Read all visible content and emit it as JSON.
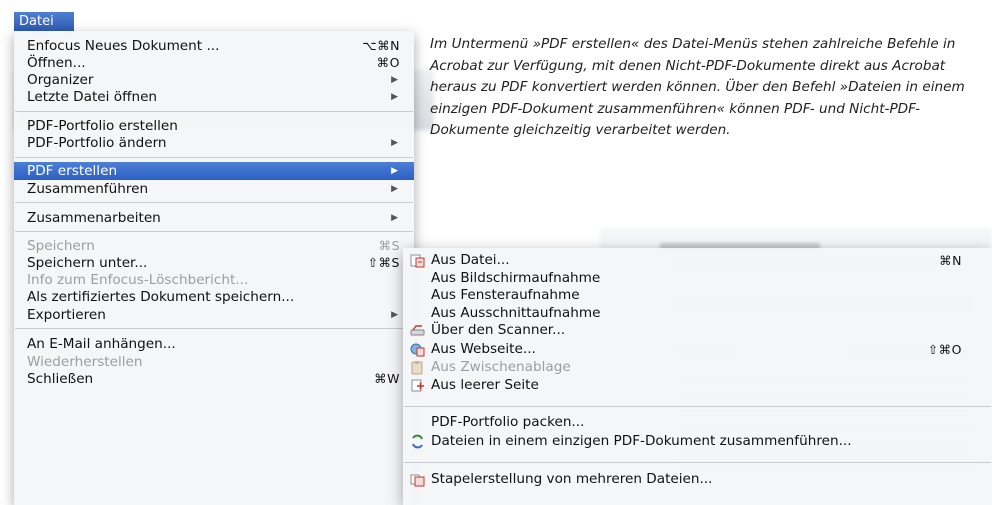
{
  "menubar": {
    "title": "Datei"
  },
  "caption": "Im Untermenü »PDF erstellen« des Datei-Menüs stehen zahlreiche Befehle in Acrobat zur Verfügung, mit denen Nicht-PDF-Dokumente direkt aus Acrobat heraus zu PDF konvertiert werden können. Über den Befehl »Dateien in einem einzigen PDF-Dokument zusammenfüh­ren« können PDF- und Nicht-PDF-Dokumente gleichzeitig verarbeitet werden.",
  "menu": {
    "items": [
      {
        "label": "Enfocus Neues Dokument ...",
        "shortcut": "⌥⌘N"
      },
      {
        "label": "Öffnen...",
        "shortcut": "⌘O"
      },
      {
        "label": "Organizer",
        "submenu_arrow": "▶"
      },
      {
        "label": "Letzte Datei öffnen",
        "submenu_arrow": "▶"
      },
      {
        "label": "PDF-Portfolio erstellen"
      },
      {
        "label": "PDF-Portfolio ändern",
        "submenu_arrow": "▶"
      },
      {
        "label": "PDF erstellen",
        "submenu_arrow": "▶",
        "highlighted": true
      },
      {
        "label": "Zusammenführen",
        "submenu_arrow": "▶"
      },
      {
        "label": "Zusammenarbeiten",
        "submenu_arrow": "▶"
      },
      {
        "label": "Speichern",
        "shortcut": "⌘S",
        "disabled": true
      },
      {
        "label": "Speichern unter...",
        "shortcut": "⇧⌘S"
      },
      {
        "label": "Info zum Enfocus-Löschbericht...",
        "disabled": true
      },
      {
        "label": "Als zertifiziertes Dokument speichern..."
      },
      {
        "label": "Exportieren",
        "submenu_arrow": "▶"
      },
      {
        "label": "An E-Mail anhängen..."
      },
      {
        "label": "Wiederherstellen",
        "disabled": true
      },
      {
        "label": "Schließen",
        "shortcut": "⌘W"
      }
    ]
  },
  "submenu": {
    "items": [
      {
        "label": "Aus Datei...",
        "shortcut": "⌘N",
        "icon": "file-to-pdf-icon"
      },
      {
        "label": "Aus Bildschirmaufnahme"
      },
      {
        "label": "Aus Fensteraufnahme"
      },
      {
        "label": "Aus Ausschnittaufnahme"
      },
      {
        "label": "Über den Scanner...",
        "icon": "scanner-icon"
      },
      {
        "label": "Aus Webseite...",
        "shortcut": "⇧⌘O",
        "icon": "webpage-icon"
      },
      {
        "label": "Aus Zwischenablage",
        "disabled": true,
        "icon": "clipboard-icon"
      },
      {
        "label": "Aus leerer Seite",
        "icon": "blank-page-icon"
      },
      {
        "label": "PDF-Portfolio packen..."
      },
      {
        "label": "Dateien in einem einzigen PDF-Dokument zusammenführen...",
        "icon": "combine-files-icon"
      },
      {
        "label": "Stapelerstellung von mehreren Dateien...",
        "icon": "batch-create-icon"
      }
    ]
  },
  "colors": {
    "highlight": "#3a6cc9",
    "disabled_text": "#9b9da2",
    "menu_bg": "#f5f6f8"
  }
}
